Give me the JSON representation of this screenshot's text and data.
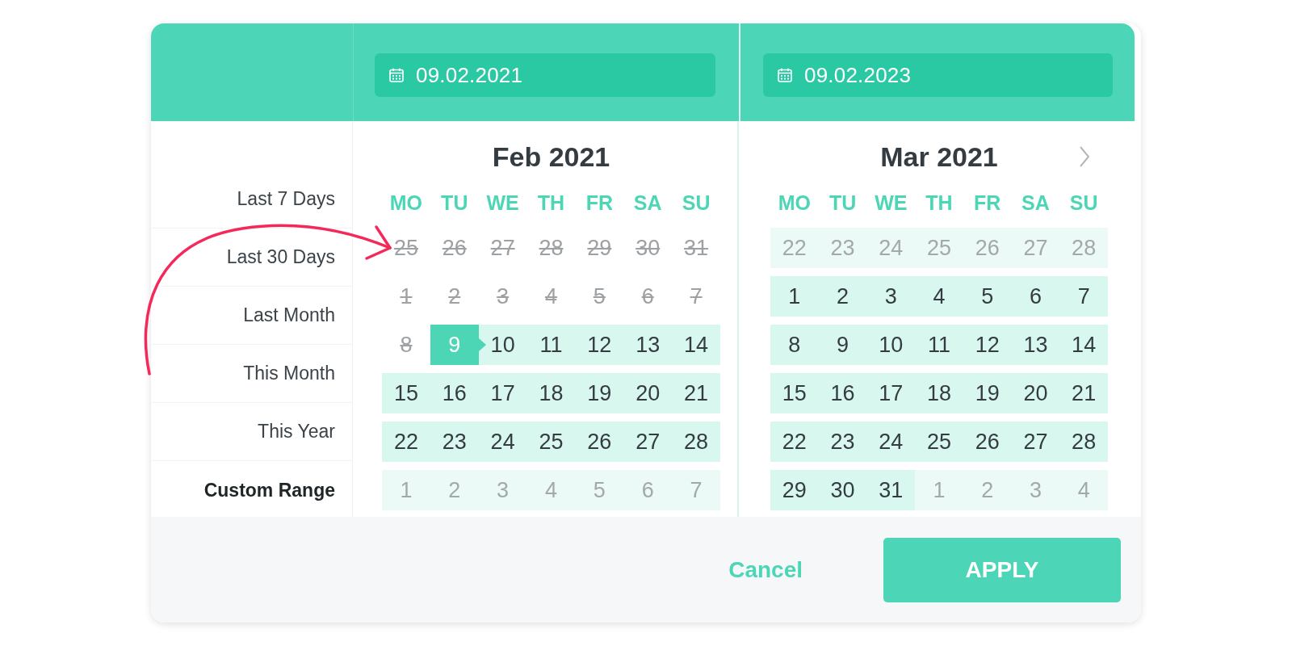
{
  "date_fields": [
    {
      "value": "09.02.2021"
    },
    {
      "value": "09.02.2023"
    }
  ],
  "presets": [
    {
      "label": "Last 7 Days",
      "selected": false
    },
    {
      "label": "Last 30 Days",
      "selected": false
    },
    {
      "label": "Last Month",
      "selected": false
    },
    {
      "label": "This Month",
      "selected": false
    },
    {
      "label": "This Year",
      "selected": false
    },
    {
      "label": "Custom Range",
      "selected": true
    }
  ],
  "calendars": [
    {
      "title": "Feb 2021",
      "next_button": false,
      "weekdays": [
        "MO",
        "TU",
        "WE",
        "TH",
        "FR",
        "SA",
        "SU"
      ],
      "days": [
        {
          "day": "25",
          "kind": "disabled",
          "selected": false
        },
        {
          "day": "26",
          "kind": "disabled",
          "selected": false
        },
        {
          "day": "27",
          "kind": "disabled",
          "selected": false
        },
        {
          "day": "28",
          "kind": "disabled",
          "selected": false
        },
        {
          "day": "29",
          "kind": "disabled",
          "selected": false
        },
        {
          "day": "30",
          "kind": "disabled",
          "selected": false
        },
        {
          "day": "31",
          "kind": "disabled",
          "selected": false
        },
        {
          "day": "1",
          "kind": "disabled",
          "selected": false
        },
        {
          "day": "2",
          "kind": "disabled",
          "selected": false
        },
        {
          "day": "3",
          "kind": "disabled",
          "selected": false
        },
        {
          "day": "4",
          "kind": "disabled",
          "selected": false
        },
        {
          "day": "5",
          "kind": "disabled",
          "selected": false
        },
        {
          "day": "6",
          "kind": "disabled",
          "selected": false
        },
        {
          "day": "7",
          "kind": "disabled",
          "selected": false
        },
        {
          "day": "8",
          "kind": "disabled",
          "selected": false
        },
        {
          "day": "9",
          "kind": "in_range",
          "selected": true
        },
        {
          "day": "10",
          "kind": "in_range",
          "selected": false
        },
        {
          "day": "11",
          "kind": "in_range",
          "selected": false
        },
        {
          "day": "12",
          "kind": "in_range",
          "selected": false
        },
        {
          "day": "13",
          "kind": "in_range",
          "selected": false
        },
        {
          "day": "14",
          "kind": "in_range",
          "selected": false
        },
        {
          "day": "15",
          "kind": "in_range",
          "selected": false
        },
        {
          "day": "16",
          "kind": "in_range",
          "selected": false
        },
        {
          "day": "17",
          "kind": "in_range",
          "selected": false
        },
        {
          "day": "18",
          "kind": "in_range",
          "selected": false
        },
        {
          "day": "19",
          "kind": "in_range",
          "selected": false
        },
        {
          "day": "20",
          "kind": "in_range",
          "selected": false
        },
        {
          "day": "21",
          "kind": "in_range",
          "selected": false
        },
        {
          "day": "22",
          "kind": "in_range",
          "selected": false
        },
        {
          "day": "23",
          "kind": "in_range",
          "selected": false
        },
        {
          "day": "24",
          "kind": "in_range",
          "selected": false
        },
        {
          "day": "25",
          "kind": "in_range",
          "selected": false
        },
        {
          "day": "26",
          "kind": "in_range",
          "selected": false
        },
        {
          "day": "27",
          "kind": "in_range",
          "selected": false
        },
        {
          "day": "28",
          "kind": "in_range",
          "selected": false
        },
        {
          "day": "1",
          "kind": "outside",
          "selected": false
        },
        {
          "day": "2",
          "kind": "outside",
          "selected": false
        },
        {
          "day": "3",
          "kind": "outside",
          "selected": false
        },
        {
          "day": "4",
          "kind": "outside",
          "selected": false
        },
        {
          "day": "5",
          "kind": "outside",
          "selected": false
        },
        {
          "day": "6",
          "kind": "outside",
          "selected": false
        },
        {
          "day": "7",
          "kind": "outside",
          "selected": false
        }
      ]
    },
    {
      "title": "Mar 2021",
      "next_button": true,
      "weekdays": [
        "MO",
        "TU",
        "WE",
        "TH",
        "FR",
        "SA",
        "SU"
      ],
      "days": [
        {
          "day": "22",
          "kind": "outside",
          "selected": false
        },
        {
          "day": "23",
          "kind": "outside",
          "selected": false
        },
        {
          "day": "24",
          "kind": "outside",
          "selected": false
        },
        {
          "day": "25",
          "kind": "outside",
          "selected": false
        },
        {
          "day": "26",
          "kind": "outside",
          "selected": false
        },
        {
          "day": "27",
          "kind": "outside",
          "selected": false
        },
        {
          "day": "28",
          "kind": "outside",
          "selected": false
        },
        {
          "day": "1",
          "kind": "in_range",
          "selected": false
        },
        {
          "day": "2",
          "kind": "in_range",
          "selected": false
        },
        {
          "day": "3",
          "kind": "in_range",
          "selected": false
        },
        {
          "day": "4",
          "kind": "in_range",
          "selected": false
        },
        {
          "day": "5",
          "kind": "in_range",
          "selected": false
        },
        {
          "day": "6",
          "kind": "in_range",
          "selected": false
        },
        {
          "day": "7",
          "kind": "in_range",
          "selected": false
        },
        {
          "day": "8",
          "kind": "in_range",
          "selected": false
        },
        {
          "day": "9",
          "kind": "in_range",
          "selected": false
        },
        {
          "day": "10",
          "kind": "in_range",
          "selected": false
        },
        {
          "day": "11",
          "kind": "in_range",
          "selected": false
        },
        {
          "day": "12",
          "kind": "in_range",
          "selected": false
        },
        {
          "day": "13",
          "kind": "in_range",
          "selected": false
        },
        {
          "day": "14",
          "kind": "in_range",
          "selected": false
        },
        {
          "day": "15",
          "kind": "in_range",
          "selected": false
        },
        {
          "day": "16",
          "kind": "in_range",
          "selected": false
        },
        {
          "day": "17",
          "kind": "in_range",
          "selected": false
        },
        {
          "day": "18",
          "kind": "in_range",
          "selected": false
        },
        {
          "day": "19",
          "kind": "in_range",
          "selected": false
        },
        {
          "day": "20",
          "kind": "in_range",
          "selected": false
        },
        {
          "day": "21",
          "kind": "in_range",
          "selected": false
        },
        {
          "day": "22",
          "kind": "in_range",
          "selected": false
        },
        {
          "day": "23",
          "kind": "in_range",
          "selected": false
        },
        {
          "day": "24",
          "kind": "in_range",
          "selected": false
        },
        {
          "day": "25",
          "kind": "in_range",
          "selected": false
        },
        {
          "day": "26",
          "kind": "in_range",
          "selected": false
        },
        {
          "day": "27",
          "kind": "in_range",
          "selected": false
        },
        {
          "day": "28",
          "kind": "in_range",
          "selected": false
        },
        {
          "day": "29",
          "kind": "in_range",
          "selected": false
        },
        {
          "day": "30",
          "kind": "in_range",
          "selected": false
        },
        {
          "day": "31",
          "kind": "in_range",
          "selected": false
        },
        {
          "day": "1",
          "kind": "outside",
          "selected": false
        },
        {
          "day": "2",
          "kind": "outside",
          "selected": false
        },
        {
          "day": "3",
          "kind": "outside",
          "selected": false
        },
        {
          "day": "4",
          "kind": "outside",
          "selected": false
        }
      ]
    }
  ],
  "footer": {
    "cancel": "Cancel",
    "apply": "APPLY"
  }
}
